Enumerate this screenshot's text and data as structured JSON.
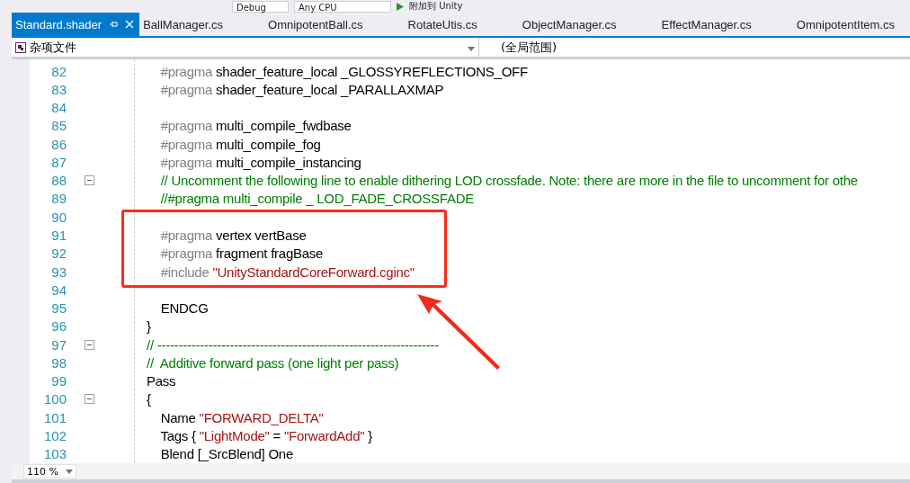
{
  "toolbar": {
    "configuration": "Debug",
    "platform": "Any CPU",
    "attach": "附加到 Unity"
  },
  "tabs": [
    {
      "label": "Standard.shader",
      "selected": true
    },
    {
      "label": "BallManager.cs",
      "selected": false
    },
    {
      "label": "OmnipotentBall.cs",
      "selected": false
    },
    {
      "label": "RotateUtis.cs",
      "selected": false
    },
    {
      "label": "ObjectManager.cs",
      "selected": false
    },
    {
      "label": "EffectManager.cs",
      "selected": false
    },
    {
      "label": "OmnipotentItem.cs",
      "selected": false
    }
  ],
  "navigation": {
    "project": "杂项文件",
    "scope": "(全局范围)"
  },
  "code_lines": [
    {
      "number": "82",
      "fold": false,
      "segments": [
        {
          "kind": "directive",
          "text": "    #pragma"
        },
        {
          "kind": "plain",
          "text": " shader_feature_local _GLOSSYREFLECTIONS_OFF"
        }
      ]
    },
    {
      "number": "83",
      "fold": false,
      "segments": [
        {
          "kind": "directive",
          "text": "    #pragma"
        },
        {
          "kind": "plain",
          "text": " shader_feature_local _PARALLAXMAP"
        }
      ]
    },
    {
      "number": "84",
      "fold": false
    },
    {
      "number": "85",
      "fold": false,
      "segments": [
        {
          "kind": "directive",
          "text": "    #pragma"
        },
        {
          "kind": "plain",
          "text": " multi_compile_fwdbase"
        }
      ]
    },
    {
      "number": "86",
      "fold": false,
      "segments": [
        {
          "kind": "directive",
          "text": "    #pragma"
        },
        {
          "kind": "plain",
          "text": " multi_compile_fog"
        }
      ]
    },
    {
      "number": "87",
      "fold": false,
      "segments": [
        {
          "kind": "directive",
          "text": "    #pragma"
        },
        {
          "kind": "plain",
          "text": " multi_compile_instancing"
        }
      ]
    },
    {
      "number": "88",
      "fold": true,
      "segments": [
        {
          "kind": "comment",
          "text": "    // Uncomment the following line to enable dithering LOD crossfade. Note: there are more in the file to uncomment for othe"
        }
      ]
    },
    {
      "number": "89",
      "fold": false,
      "segments": [
        {
          "kind": "comment",
          "text": "    //#pragma multi_compile _ LOD_FADE_CROSSFADE"
        }
      ]
    },
    {
      "number": "90",
      "fold": false
    },
    {
      "number": "91",
      "fold": false,
      "segments": [
        {
          "kind": "directive",
          "text": "    #pragma"
        },
        {
          "kind": "plain",
          "text": " vertex vertBase"
        }
      ]
    },
    {
      "number": "92",
      "fold": false,
      "segments": [
        {
          "kind": "directive",
          "text": "    #pragma"
        },
        {
          "kind": "plain",
          "text": " fragment fragBase"
        }
      ]
    },
    {
      "number": "93",
      "fold": false,
      "segments": [
        {
          "kind": "directive",
          "text": "    #include"
        },
        {
          "kind": "string",
          "text": " \"UnityStandardCoreForward.cginc\""
        }
      ]
    },
    {
      "number": "94",
      "fold": false
    },
    {
      "number": "95",
      "fold": false,
      "segments": [
        {
          "kind": "plain",
          "text": "    ENDCG"
        }
      ]
    },
    {
      "number": "96",
      "fold": false,
      "segments": [
        {
          "kind": "plain",
          "text": "}"
        }
      ]
    },
    {
      "number": "97",
      "fold": true,
      "segments": [
        {
          "kind": "comment",
          "text": "// ------------------------------------------------------------------"
        }
      ]
    },
    {
      "number": "98",
      "fold": false,
      "segments": [
        {
          "kind": "comment",
          "text": "//  Additive forward pass (one light per pass)"
        }
      ]
    },
    {
      "number": "99",
      "fold": false,
      "segments": [
        {
          "kind": "plain",
          "text": "Pass"
        }
      ]
    },
    {
      "number": "100",
      "fold": true,
      "segments": [
        {
          "kind": "plain",
          "text": "{"
        }
      ]
    },
    {
      "number": "101",
      "fold": false,
      "segments": [
        {
          "kind": "plain",
          "text": "    Name "
        },
        {
          "kind": "string",
          "text": "\"FORWARD_DELTA\""
        }
      ]
    },
    {
      "number": "102",
      "fold": false,
      "segments": [
        {
          "kind": "plain",
          "text": "    Tags { "
        },
        {
          "kind": "string",
          "text": "\"LightMode\""
        },
        {
          "kind": "plain",
          "text": " = "
        },
        {
          "kind": "string",
          "text": "\"ForwardAdd\""
        },
        {
          "kind": "plain",
          "text": " }"
        }
      ]
    },
    {
      "number": "103",
      "fold": false,
      "segments": [
        {
          "kind": "plain",
          "text": "    Blend [_SrcBlend] One"
        }
      ]
    }
  ],
  "zoom": "110 %"
}
